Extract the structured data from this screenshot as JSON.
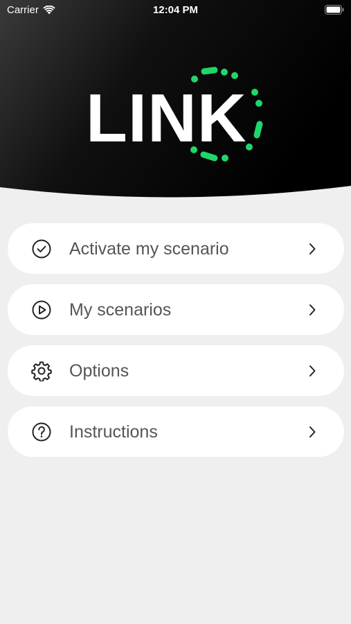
{
  "status_bar": {
    "carrier": "Carrier",
    "time": "12:04 PM",
    "wifi_icon": "wifi-icon",
    "battery_icon": "battery-icon"
  },
  "header": {
    "logo_text": "LINK",
    "accent_color": "#1fd66b",
    "background_color": "#000000"
  },
  "menu": {
    "items": [
      {
        "label": "Activate my scenario",
        "icon": "check-circle-icon"
      },
      {
        "label": "My scenarios",
        "icon": "play-circle-icon"
      },
      {
        "label": "Options",
        "icon": "gear-icon"
      },
      {
        "label": "Instructions",
        "icon": "question-circle-icon"
      }
    ]
  }
}
